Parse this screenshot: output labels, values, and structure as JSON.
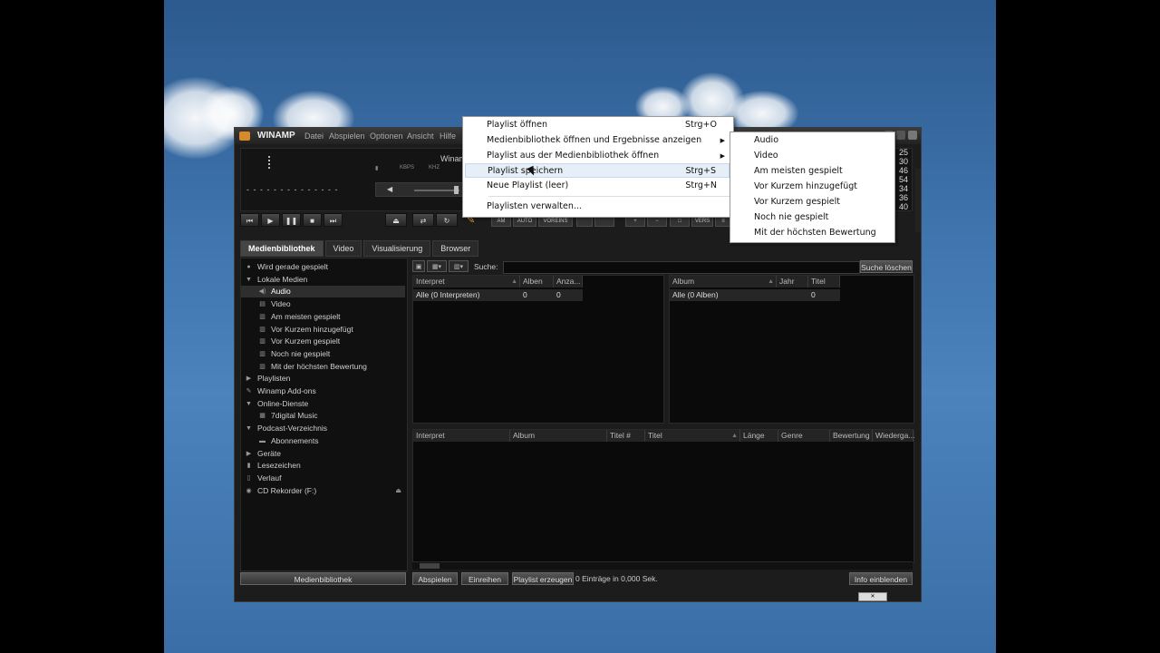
{
  "window": {
    "brand": "WINAMP",
    "menu": [
      "Datei",
      "Abspielen",
      "Optionen",
      "Ansicht",
      "Hilfe"
    ]
  },
  "player": {
    "display_title": "Winamp",
    "bitrate_labels": [
      "KBPS",
      "KHZ"
    ],
    "time_dashes": "- - - - - - - - - - - - - -",
    "eq_numbers": [
      "25",
      "30",
      "46",
      "54",
      "34",
      "36",
      "40"
    ],
    "mini_buttons": [
      "AM",
      "AUTO",
      "VOREINS",
      "",
      "",
      "",
      "",
      "",
      "VERS",
      ""
    ]
  },
  "tabs": [
    "Medienbibliothek",
    "Video",
    "Visualisierung",
    "Browser"
  ],
  "tree": [
    {
      "label": "Wird gerade gespielt",
      "icon": "now-playing-icon",
      "indent": 0
    },
    {
      "label": "Lokale Medien",
      "icon": "expand-icon",
      "indent": 0
    },
    {
      "label": "Audio",
      "icon": "speaker-icon",
      "indent": 1,
      "selected": true
    },
    {
      "label": "Video",
      "icon": "video-icon",
      "indent": 1
    },
    {
      "label": "Am meisten gespielt",
      "icon": "smart-view-icon",
      "indent": 1
    },
    {
      "label": "Vor Kurzem hinzugefügt",
      "icon": "smart-view-icon",
      "indent": 1
    },
    {
      "label": "Vor Kurzem gespielt",
      "icon": "smart-view-icon",
      "indent": 1
    },
    {
      "label": "Noch nie gespielt",
      "icon": "smart-view-icon",
      "indent": 1
    },
    {
      "label": "Mit der höchsten Bewertung",
      "icon": "smart-view-icon",
      "indent": 1
    },
    {
      "label": "Playlisten",
      "icon": "collapse-icon",
      "indent": 0
    },
    {
      "label": "Winamp Add-ons",
      "icon": "addons-icon",
      "indent": 0
    },
    {
      "label": "Online-Dienste",
      "icon": "expand-icon",
      "indent": 0
    },
    {
      "label": "7digital Music",
      "icon": "store-icon",
      "indent": 1
    },
    {
      "label": "Podcast-Verzeichnis",
      "icon": "expand-icon",
      "indent": 0
    },
    {
      "label": "Abonnements",
      "icon": "folder-icon",
      "indent": 1
    },
    {
      "label": "Geräte",
      "icon": "collapse-icon",
      "indent": 0
    },
    {
      "label": "Lesezeichen",
      "icon": "bookmark-icon",
      "indent": 0
    },
    {
      "label": "Verlauf",
      "icon": "history-icon",
      "indent": 0
    },
    {
      "label": "CD Rekorder (F:)",
      "icon": "cd-icon",
      "indent": 0
    }
  ],
  "tree_bottom_label": "Medienbibliothek",
  "search": {
    "label": "Suche:",
    "clear_label": "Suche löschen",
    "value": ""
  },
  "artist_panel": {
    "columns": [
      "Interpret",
      "Alben",
      "Anza..."
    ],
    "row": [
      "Alle (0 Interpreten)",
      "0",
      "0"
    ]
  },
  "album_panel": {
    "columns": [
      "Album",
      "Jahr",
      "Titel"
    ],
    "row": [
      "Alle (0 Alben)",
      "",
      "0"
    ]
  },
  "tracks_panel": {
    "columns": [
      "Interpret",
      "Album",
      "Titel #",
      "Titel",
      "Länge",
      "Genre",
      "Bewertung",
      "Wiederga..."
    ]
  },
  "bottom": {
    "play_label": "Abspielen",
    "enqueue_label": "Einreihen",
    "create_playlist_label": "Playlist erzeugen",
    "status": "0 Einträge  in 0,000 Sek.",
    "info_label": "Info einblenden"
  },
  "context_menu": {
    "items": [
      {
        "label": "Playlist öffnen",
        "shortcut": "Strg+O"
      },
      {
        "label": "Medienbibliothek öffnen und Ergebnisse anzeigen",
        "submenu": true
      },
      {
        "label": "Playlist aus der Medienbibliothek öffnen",
        "submenu": true
      },
      {
        "label": "Playlist speichern",
        "shortcut": "Strg+S",
        "highlighted": true
      },
      {
        "label": "Neue Playlist (leer)",
        "shortcut": "Strg+N"
      },
      {
        "label": "Playlisten verwalten..."
      }
    ]
  },
  "submenu": {
    "items": [
      "Audio",
      "Video",
      "Am meisten gespielt",
      "Vor Kurzem hinzugefügt",
      "Vor Kurzem gespielt",
      "Noch nie gespielt",
      "Mit der höchsten Bewertung"
    ]
  }
}
